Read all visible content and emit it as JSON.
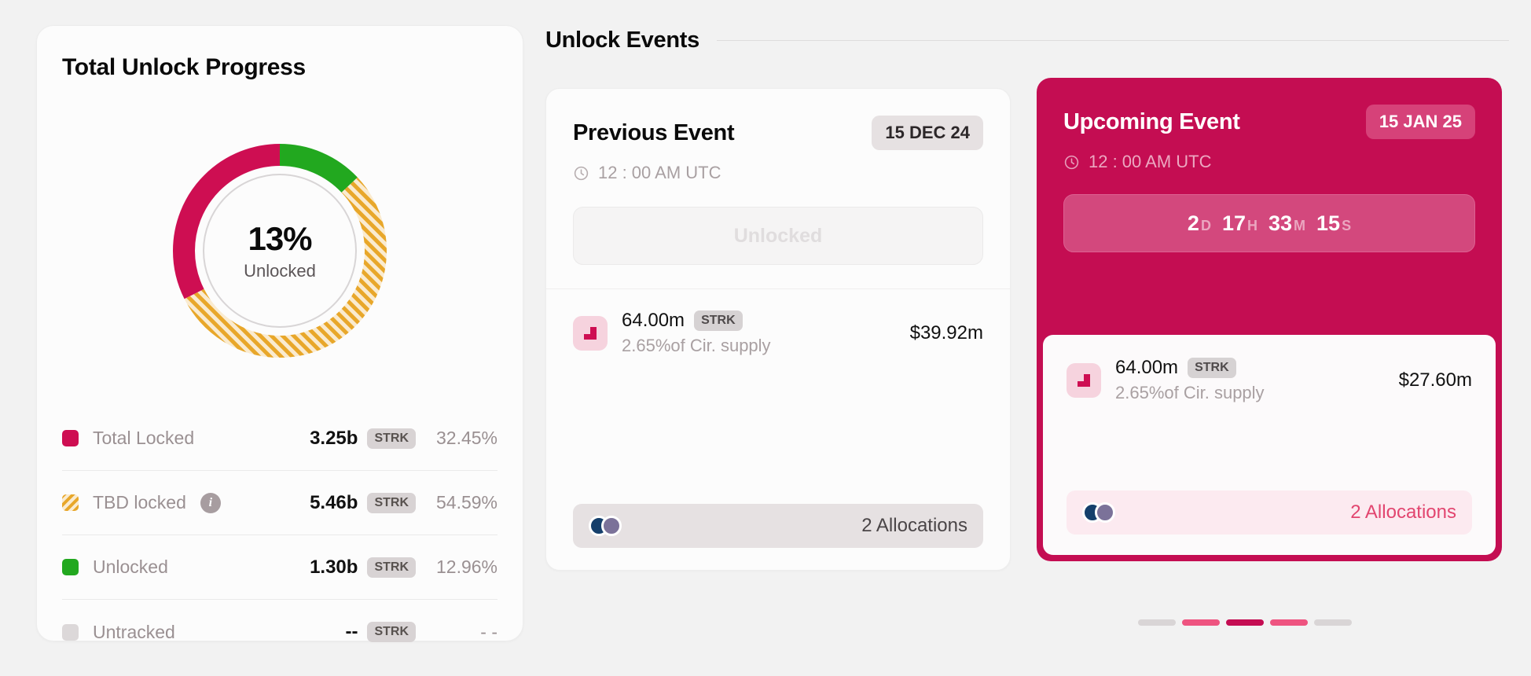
{
  "left_panel": {
    "title": "Total Unlock Progress",
    "donut": {
      "center_value": "13%",
      "center_label": "Unlocked"
    },
    "legend": [
      {
        "label": "Total Locked",
        "value": "3.25b",
        "chip": "STRK",
        "percent": "32.45%",
        "color": "#CE0E52",
        "style": "solid",
        "has_info": false
      },
      {
        "label": "TBD locked",
        "value": "5.46b",
        "chip": "STRK",
        "percent": "54.59%",
        "color": "#E8A72A",
        "style": "striped",
        "has_info": true
      },
      {
        "label": "Unlocked",
        "value": "1.30b",
        "chip": "STRK",
        "percent": "12.96%",
        "color": "#22A81F",
        "style": "solid",
        "has_info": false
      },
      {
        "label": "Untracked",
        "value": "--",
        "chip": "STRK",
        "percent": "- -",
        "color": "#DCD8D9",
        "style": "solid",
        "has_info": false
      }
    ]
  },
  "events": {
    "section_title": "Unlock Events",
    "previous": {
      "name": "Previous Event",
      "date_badge": "15 DEC 24",
      "time": "12 : 00 AM UTC",
      "status_button": "Unlocked",
      "allocation": {
        "amount": "64.00m",
        "chip": "STRK",
        "supply_note": "2.65%of Cir. supply",
        "usd": "$39.92m"
      },
      "footer_label": "2 Allocations"
    },
    "upcoming": {
      "name": "Upcoming Event",
      "date_badge": "15 JAN 25",
      "time": "12 : 00 AM UTC",
      "countdown": [
        {
          "num": "2",
          "unit": "D"
        },
        {
          "num": "17",
          "unit": "H"
        },
        {
          "num": "33",
          "unit": "M"
        },
        {
          "num": "15",
          "unit": "S"
        }
      ],
      "allocation": {
        "amount": "64.00m",
        "chip": "STRK",
        "supply_note": "2.65%of Cir. supply",
        "usd": "$27.60m"
      },
      "footer_label": "2 Allocations"
    }
  },
  "pagination": {
    "dots": [
      {
        "color": "#D9D5D6"
      },
      {
        "color": "#EE5480"
      },
      {
        "color": "#C40D52"
      },
      {
        "color": "#EE5480"
      },
      {
        "color": "#D9D5D6"
      }
    ]
  },
  "chart_data": {
    "type": "pie",
    "title": "Total Unlock Progress",
    "categories": [
      "Unlocked",
      "TBD locked",
      "Total Locked",
      "Untracked"
    ],
    "values": [
      12.96,
      54.59,
      32.45,
      0
    ],
    "token_amounts": [
      "1.30b",
      "5.46b",
      "3.25b",
      "--"
    ],
    "unit": "STRK",
    "colors": [
      "#22A81F",
      "#E8A72A",
      "#CE0E52",
      "#DCD8D9"
    ],
    "center_value": "13%",
    "center_label": "Unlocked",
    "start_angle_deg": 0,
    "direction": "clockwise",
    "legend": "below"
  }
}
